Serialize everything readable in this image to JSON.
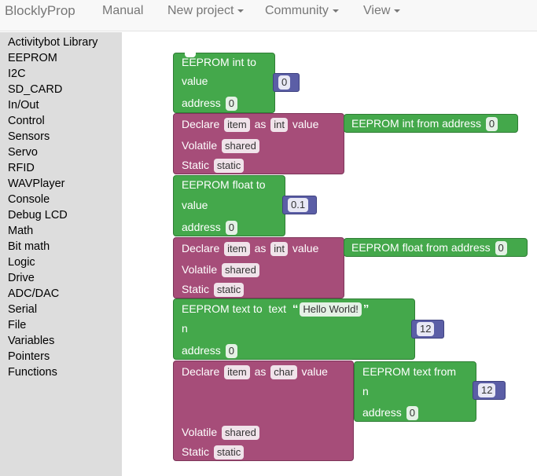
{
  "navbar": {
    "brand": "BlocklyProp",
    "items": [
      {
        "label": "Manual",
        "dropdown": false
      },
      {
        "label": "New project",
        "dropdown": true
      },
      {
        "label": "Community",
        "dropdown": true
      },
      {
        "label": "View",
        "dropdown": true
      }
    ]
  },
  "toolbox": [
    "Activitybot Library",
    "EEPROM",
    "I2C",
    "SD_CARD",
    "In/Out",
    "Control",
    "Sensors",
    "Servo",
    "RFID",
    "WAVPlayer",
    "Console",
    "Debug LCD",
    "Math",
    "Bit math",
    "Logic",
    "Drive",
    "ADC/DAC",
    "Serial",
    "File",
    "Variables",
    "Pointers",
    "Functions"
  ],
  "blocks": {
    "b1": {
      "title": "EEPROM int to",
      "value": "value",
      "address": "address",
      "address_val": "0",
      "num": "0"
    },
    "b2": {
      "declare": "Declare",
      "item": "item",
      "as": "as",
      "type": "int",
      "value": "value",
      "read": "EEPROM int from",
      "address": "address",
      "address_val": "0",
      "volatile": "Volatile",
      "shared": "shared",
      "static": "Static",
      "static_val": "static"
    },
    "b3": {
      "title": "EEPROM float to",
      "value": "value",
      "address": "address",
      "address_val": "0",
      "num": "0.1"
    },
    "b4": {
      "declare": "Declare",
      "item": "item",
      "as": "as",
      "type": "int",
      "value": "value",
      "read": "EEPROM float from",
      "address": "address",
      "address_val": "0",
      "volatile": "Volatile",
      "shared": "shared",
      "static": "Static",
      "static_val": "static"
    },
    "b5": {
      "title": "EEPROM text to",
      "text": "text",
      "open_quote": "“",
      "close_quote": "”",
      "text_val": "Hello World!",
      "n": "n",
      "num": "12",
      "address": "address",
      "address_val": "0"
    },
    "b6": {
      "declare": "Declare",
      "item": "item",
      "as": "as",
      "type": "char",
      "value": "value",
      "read": "EEPROM text from",
      "n": "n",
      "num": "12",
      "address": "address",
      "address_val": "0",
      "volatile": "Volatile",
      "shared": "shared",
      "static": "Static",
      "static_val": "static"
    }
  },
  "colors": {
    "green": "#44a84b",
    "magenta": "#a64d79",
    "math": "#5b5ea6"
  }
}
